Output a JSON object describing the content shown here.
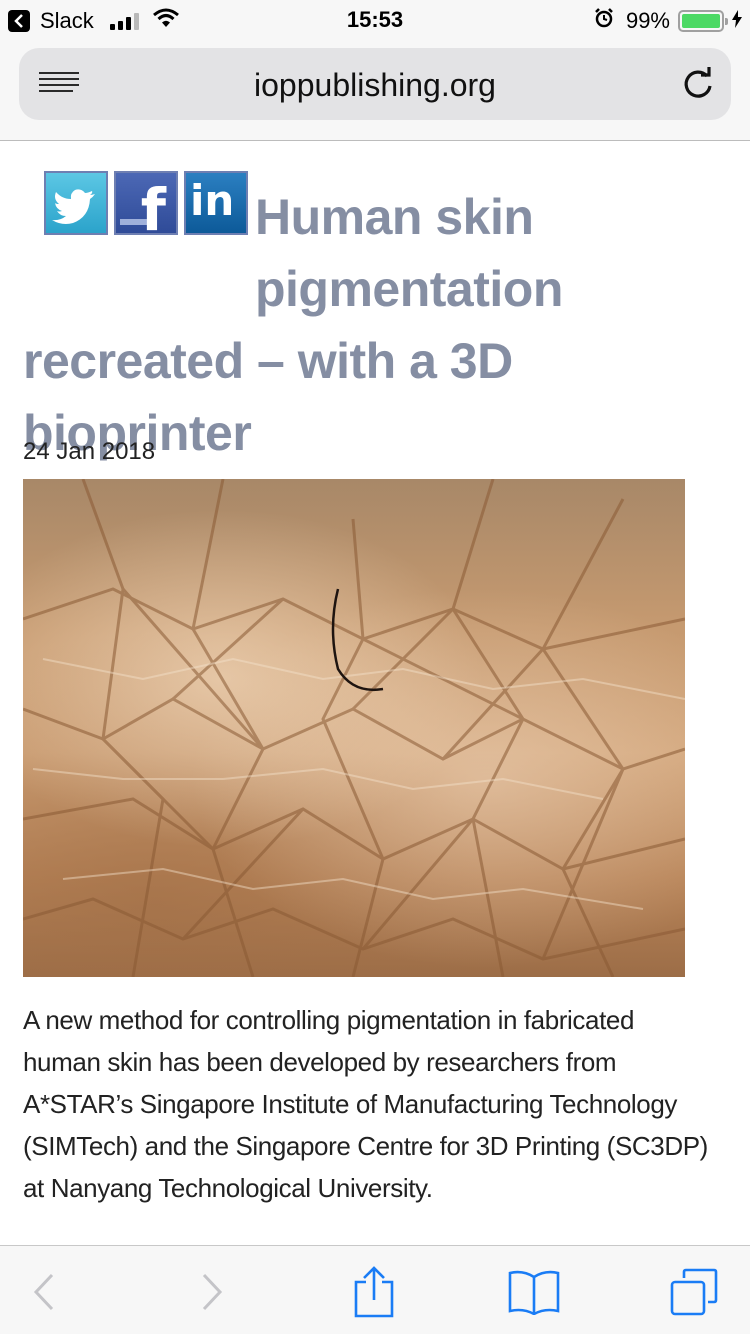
{
  "status_bar": {
    "back_app": "Slack",
    "time": "15:53",
    "battery_percent": "99%",
    "battery_level": 0.99,
    "signal_bars": 3
  },
  "browser": {
    "url": "ioppublishing.org"
  },
  "social": {
    "twitter_icon": "twitter-icon",
    "facebook_icon": "facebook-icon",
    "linkedin_icon": "linkedin-icon",
    "facebook_glyph": "f",
    "linkedin_glyph": "in"
  },
  "article": {
    "title_line1": "Human skin",
    "title_line2": "pigmentation",
    "title_line3": "recreated – with a 3D bioprinter",
    "date": "24 Jan 2018",
    "image_icon": "skin-closeup-photo",
    "body_line1": "A new method for controlling pigmentation in fabricated",
    "body_line2": "human skin has been developed by researchers from",
    "body_line3": "A*STAR’s Singapore Institute of Manufacturing Technology",
    "body_line4": "(SIMTech) and the Singapore Centre for 3D Printing (SC3DP)",
    "body_line5": "at Nanyang Technological University."
  },
  "toolbar": {
    "back_icon": "chevron-left-icon",
    "forward_icon": "chevron-right-icon",
    "share_icon": "share-icon",
    "bookmarks_icon": "book-icon",
    "tabs_icon": "tabs-icon"
  },
  "colors": {
    "accent": "#1a7cf5",
    "title": "#858ea3",
    "battery": "#4cd964"
  }
}
